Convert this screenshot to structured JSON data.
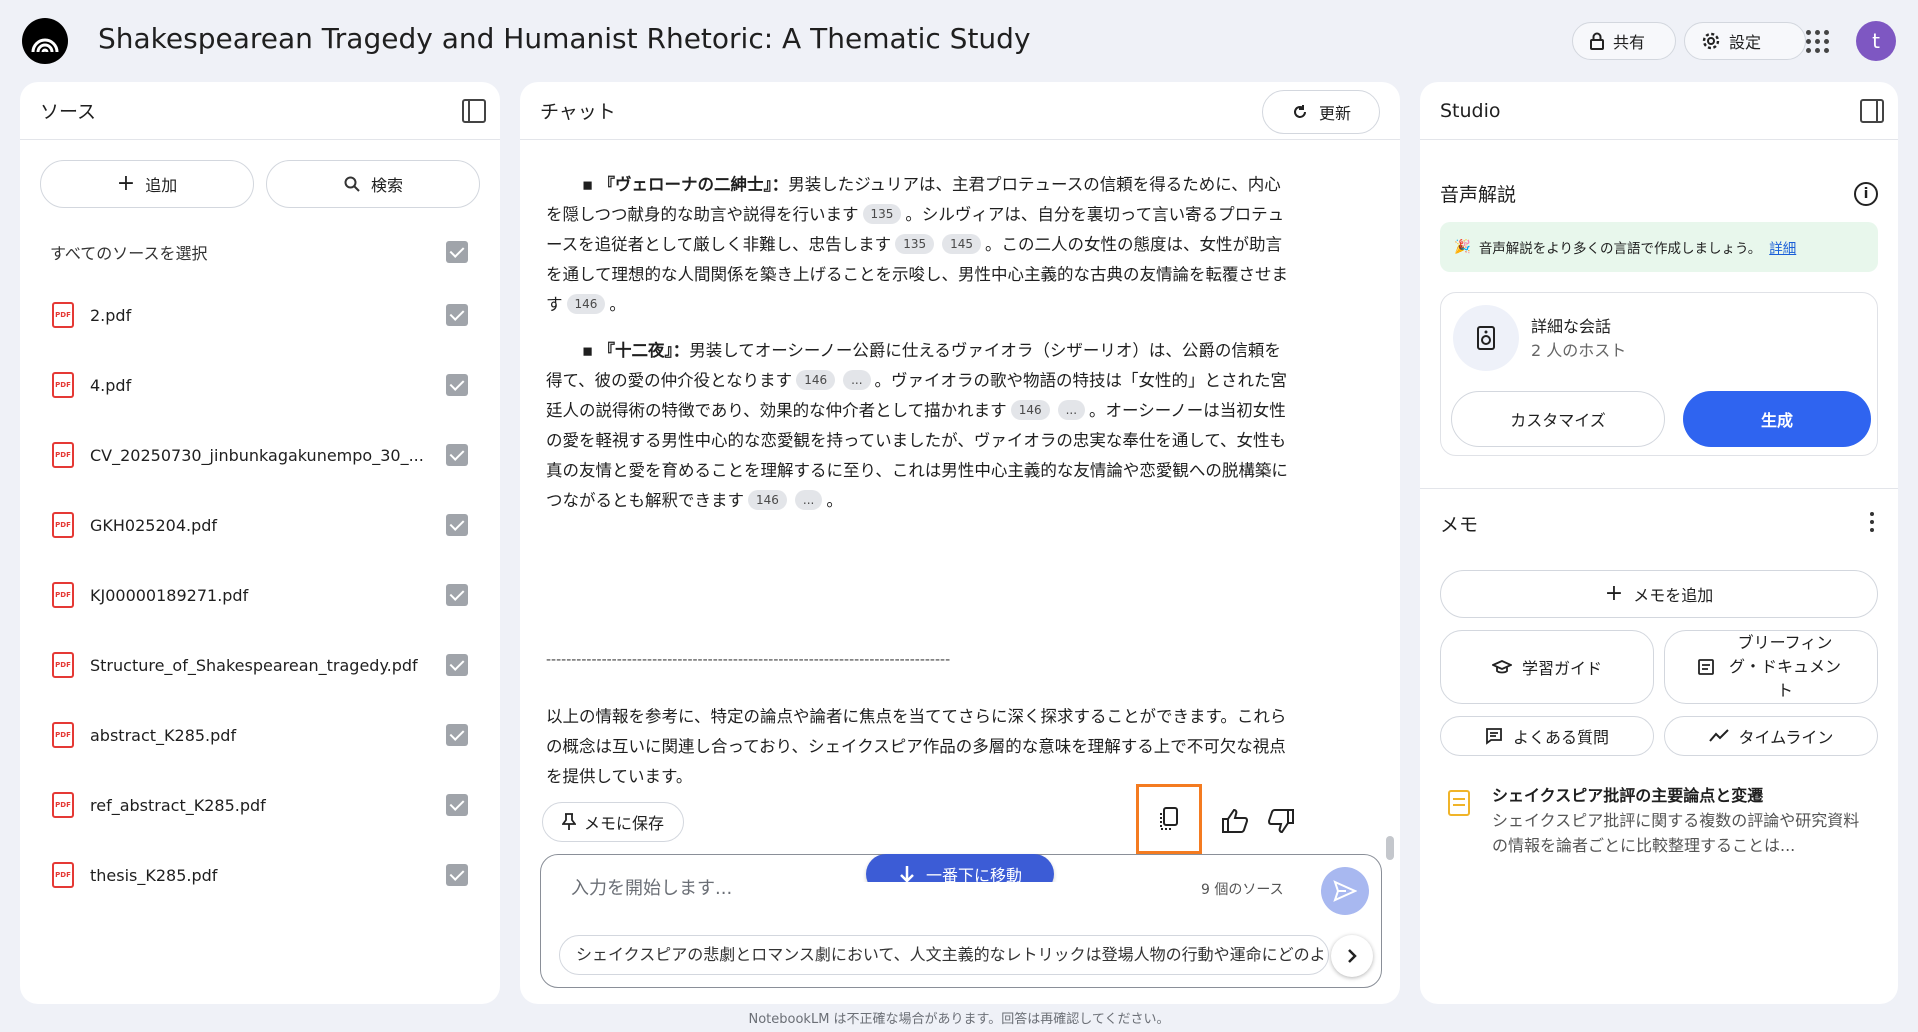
{
  "app": {
    "title": "Shakespearean Tragedy and Humanist Rhetoric: A Thematic Study",
    "share_label": "共有",
    "settings_label": "設定",
    "avatar_initial": "t"
  },
  "sources": {
    "title": "ソース",
    "add_label": "追加",
    "search_label": "検索",
    "select_all_label": "すべてのソースを選択",
    "items": [
      {
        "name": "2.pdf"
      },
      {
        "name": "4.pdf"
      },
      {
        "name": "CV_20250730_jinbunkagakunempo_30_..."
      },
      {
        "name": "GKH025204.pdf"
      },
      {
        "name": "KJ00000189271.pdf"
      },
      {
        "name": "Structure_of_Shakespearean_tragedy.pdf"
      },
      {
        "name": "abstract_K285.pdf"
      },
      {
        "name": "ref_abstract_K285.pdf"
      },
      {
        "name": "thesis_K285.pdf"
      }
    ]
  },
  "chat": {
    "title": "チャット",
    "refresh_label": "更新",
    "bullet1": {
      "heading": "『ヴェローナの二紳士』：",
      "part1": "男装したジュリアは、主君プロテュースの信頼を得るために、内心を隠しつつ献身的な助言や説得を行います",
      "cite1": "135",
      "part2": "。シルヴィアは、自分を裏切って言い寄るプロテュースを追従者として厳しく非難し、忠告します",
      "cite2": "135",
      "cite3": "145",
      "part3": "。この二人の女性の態度は、女性が助言を通して理想的な人間関係を築き上げることを示唆し、男性中心主義的な古典の友情論を転覆させます",
      "cite4": "146",
      "part4": "。"
    },
    "bullet2": {
      "heading": "『十二夜』：",
      "part1": "男装してオーシーノー公爵に仕えるヴァイオラ（シザーリオ）は、公爵の信頼を得て、彼の愛の仲介役となります",
      "cite1": "146",
      "cite_more1": "...",
      "part2": "。ヴァイオラの歌や物語の特技は「女性的」とされた宮廷人の説得術の特徴であり、効果的な仲介者として描かれます",
      "cite2": "146",
      "cite_more2": "...",
      "part3": "。オーシーノーは当初女性の愛を軽視する男性中心的な恋愛観を持っていましたが、ヴァイオラの忠実な奉仕を通して、女性も真の友情と愛を育めることを理解するに至り、これは男性中心主義的な友情論や恋愛観への脱構築につながるとも解釈できます",
      "cite3": "146",
      "cite_more3": "...",
      "part4": "。"
    },
    "divider": "--------------------------------------------------------------------------------",
    "conclusion": "以上の情報を参考に、特定の論点や論者に焦点を当ててさらに深く探求することができます。これらの概念は互いに関連し合っており、シェイクスピア作品の多層的な意味を理解する上で不可欠な視点を提供しています。",
    "save_note_label": "メモに保存",
    "scroll_bottom_label": "一番下に移動",
    "input_placeholder": "入力を開始します...",
    "source_count": "9 個のソース",
    "suggestion": "シェイクスピアの悲劇とロマンス劇において、人文主義的なレトリックは登場人物の行動や運命にどのような影響を与えていますか？"
  },
  "studio": {
    "title": "Studio",
    "audio_title": "音声解説",
    "banner_text": "音声解説をより多くの言語で作成しましょう。",
    "banner_link": "詳細",
    "card_title": "詳細な会話",
    "card_sub": "2 人のホスト",
    "customize_label": "カスタマイズ",
    "generate_label": "生成",
    "memo_title": "メモ",
    "add_memo_label": "メモを追加",
    "study_guide_label": "学習ガイド",
    "briefing_label": "ブリーフィング・ドキュメント",
    "faq_label": "よくある質問",
    "timeline_label": "タイムライン",
    "note_title": "シェイクスピア批評の主要論点と変遷",
    "note_desc": "シェイクスピア批評に関する複数の評論や研究資料の情報を論者ごとに比較整理することは..."
  },
  "footer": "NotebookLM は不正確な場合があります。回答は再確認してください。",
  "colors": {
    "accent": "#2f64f0",
    "highlight": "#f47b20",
    "pdf_red": "#e53935",
    "avatar": "#7e57c2"
  }
}
